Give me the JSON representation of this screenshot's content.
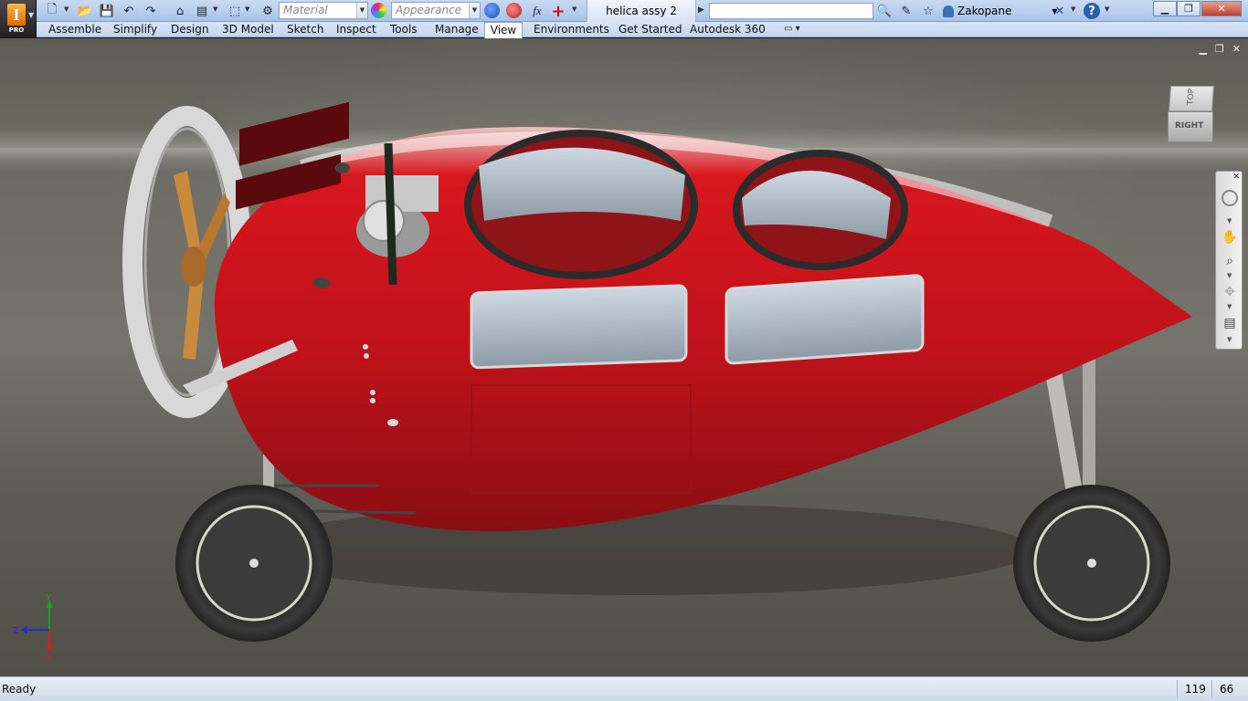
{
  "app": {
    "logo_letter": "I",
    "edition": "PRO",
    "document_title": "helica assy 2"
  },
  "quick_access": {
    "icons": [
      "new-icon",
      "open-icon",
      "save-icon",
      "undo-icon",
      "redo-icon",
      "home-icon",
      "project-icon",
      "select-icon",
      "update-icon"
    ],
    "material_placeholder": "Material",
    "appearance_placeholder": "Appearance",
    "function_symbol": "fx"
  },
  "search": {
    "value": "",
    "placeholder": ""
  },
  "user": {
    "name": "Zakopane"
  },
  "help_symbol": "?",
  "ribbon": {
    "tabs": [
      "Assemble",
      "Simplify",
      "Design",
      "3D Model",
      "Sketch",
      "Inspect",
      "Tools",
      "Manage",
      "View",
      "Environments",
      "Get Started",
      "Autodesk 360"
    ],
    "active_tab": "View"
  },
  "viewcube": {
    "top_label": "TOP",
    "front_label": "RIGHT"
  },
  "triad": {
    "x": "X",
    "y": "Y",
    "z": "Z"
  },
  "status": {
    "text": "Ready",
    "value1": "119",
    "value2": "66"
  },
  "colors": {
    "body_red": "#c8141c",
    "ribbon_blue": "#c2d5ee",
    "axis_x": "#d02020",
    "axis_y": "#20a020",
    "axis_z": "#2030d0"
  }
}
